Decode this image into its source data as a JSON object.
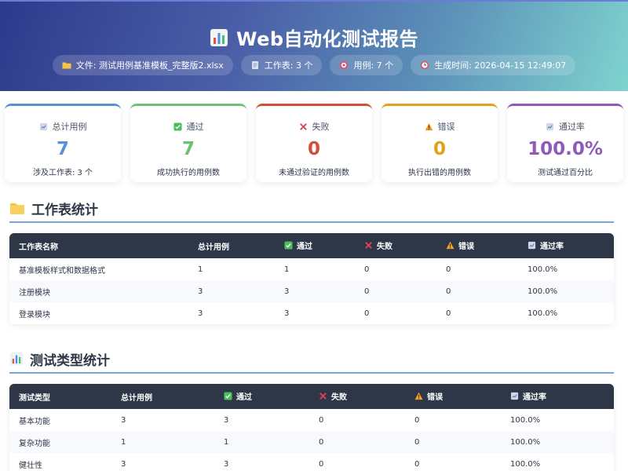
{
  "header": {
    "title": "Web自动化测试报告",
    "file": "文件: 测试用例基准模板_完整版2.xlsx",
    "sheets": "工作表: 3 个",
    "cases": "用例: 7 个",
    "generated": "生成时间: 2026-04-15 12:49:07"
  },
  "cards": [
    {
      "label": "总计用例",
      "value": "7",
      "sub": "涉及工作表: 3 个",
      "color": "#5b8fd6",
      "icon": "notepad-icon"
    },
    {
      "label": "通过",
      "value": "7",
      "sub": "成功执行的用例数",
      "color": "#6cc070",
      "icon": "check-icon"
    },
    {
      "label": "失败",
      "value": "0",
      "sub": "未通过验证的用例数",
      "color": "#d0503a",
      "icon": "cross-icon"
    },
    {
      "label": "错误",
      "value": "0",
      "sub": "执行出错的用例数",
      "color": "#e0a11b",
      "icon": "warning-icon"
    },
    {
      "label": "通过率",
      "value": "100.0%",
      "sub": "测试通过百分比",
      "color": "#8e5bb8",
      "icon": "chart-icon"
    }
  ],
  "sheet_stats": {
    "title": "工作表统计",
    "headers": [
      "工作表名称",
      "总计用例",
      "通过",
      "失败",
      "错误",
      "通过率"
    ],
    "rows": [
      [
        "基准模板样式和数据格式",
        "1",
        "1",
        "0",
        "0",
        "100.0%"
      ],
      [
        "注册模块",
        "3",
        "3",
        "0",
        "0",
        "100.0%"
      ],
      [
        "登录模块",
        "3",
        "3",
        "0",
        "0",
        "100.0%"
      ]
    ]
  },
  "type_stats": {
    "title": "测试类型统计",
    "headers": [
      "测试类型",
      "总计用例",
      "通过",
      "失败",
      "错误",
      "通过率"
    ],
    "rows": [
      [
        "基本功能",
        "3",
        "3",
        "0",
        "0",
        "100.0%"
      ],
      [
        "复杂功能",
        "1",
        "1",
        "0",
        "0",
        "100.0%"
      ],
      [
        "健壮性",
        "3",
        "3",
        "0",
        "0",
        "100.0%"
      ]
    ]
  }
}
